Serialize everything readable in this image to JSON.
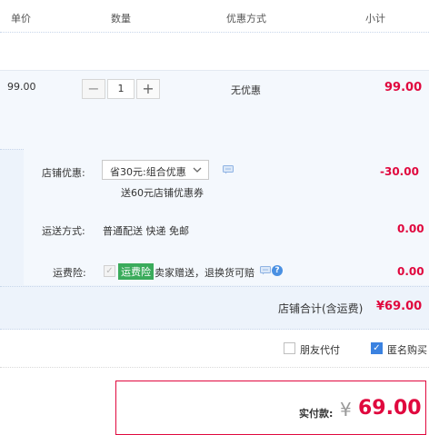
{
  "header": {
    "col_price": "单价",
    "col_qty": "数量",
    "col_discount": "优惠方式",
    "col_subtotal": "小计"
  },
  "item": {
    "price": "99.00",
    "quantity": "1",
    "discount": "无优惠",
    "subtotal": "99.00",
    "minus_symbol": "−",
    "plus_symbol": "+"
  },
  "shop_promo": {
    "label": "店铺优惠:",
    "selected": "省30元:组合优惠",
    "note": "送60元店铺优惠券",
    "amount": "-30.00",
    "icon": "chat-icon"
  },
  "shipping": {
    "label": "运送方式:",
    "method": "普通配送 快递 免邮",
    "amount": "0.00"
  },
  "insurance": {
    "label": "运费险:",
    "checked": true,
    "badge": "运费险",
    "text": "卖家赠送，退换货可赔",
    "amount": "0.00",
    "icons": [
      "chat-icon",
      "help-icon"
    ],
    "help_glyph": "?"
  },
  "shop_total": {
    "label": "店铺合计(含运费)",
    "value": "¥69.00"
  },
  "options": {
    "friend_pay_label": "朋友代付",
    "friend_pay_checked": false,
    "anonymous_label": "匿名购买",
    "anonymous_checked": true
  },
  "payment": {
    "label": "实付款:",
    "currency": "¥",
    "amount": "69.00"
  },
  "colors": {
    "price_red": "#e0083e",
    "panel_bg": "#edf3fb",
    "badge_green": "#3aab5b",
    "check_blue": "#3b82e0"
  }
}
